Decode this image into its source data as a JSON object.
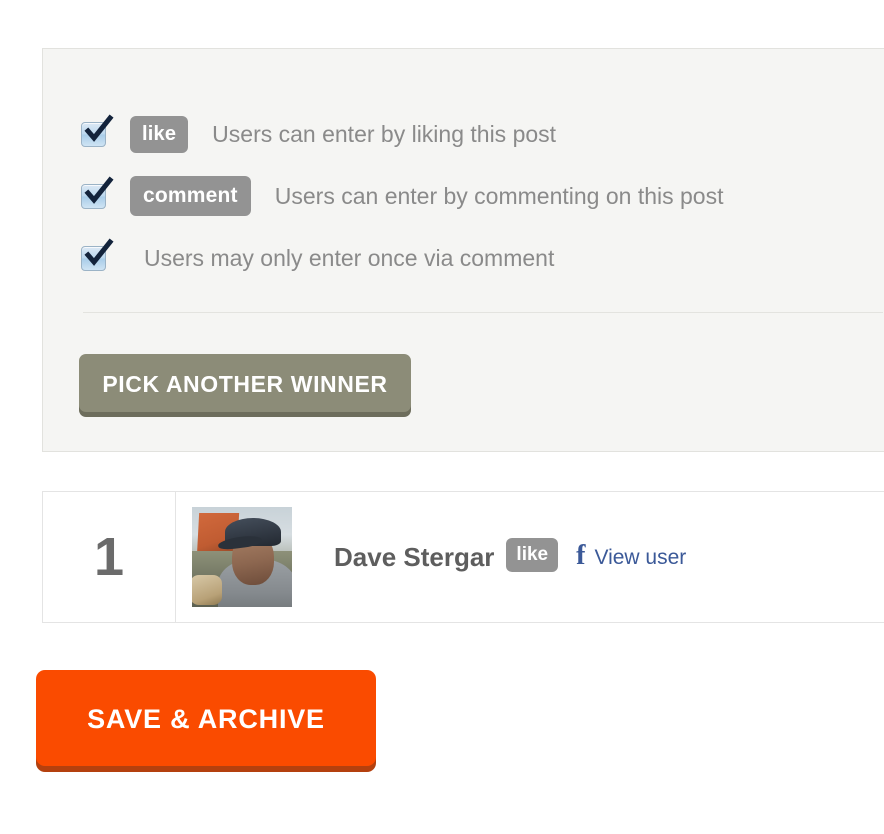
{
  "settings": {
    "options": [
      {
        "checked": true,
        "badge": "like",
        "label": "Users can enter by liking this post"
      },
      {
        "checked": true,
        "badge": "comment",
        "label": "Users can enter by commenting on this post"
      },
      {
        "checked": true,
        "badge": null,
        "label": "Users may only enter once via comment"
      }
    ],
    "pick_another_winner_label": "PICK ANOTHER WINNER"
  },
  "winners": {
    "rows": [
      {
        "rank": "1",
        "name": "Dave Stergar",
        "entry_method_badge": "like",
        "profile_link_label": "View user",
        "profile_icon": "facebook-f-icon"
      }
    ]
  },
  "actions": {
    "save_archive_label": "SAVE & ARCHIVE"
  },
  "colors": {
    "accent_orange": "#fa4b00",
    "accent_orange_shadow": "#b4400e",
    "olive_button": "#8c8c78",
    "olive_button_shadow": "#6d6d5c",
    "badge_gray": "#939393",
    "facebook_blue": "#3b5998",
    "panel_background": "#f5f5f3",
    "muted_text": "#8a8a8a"
  }
}
